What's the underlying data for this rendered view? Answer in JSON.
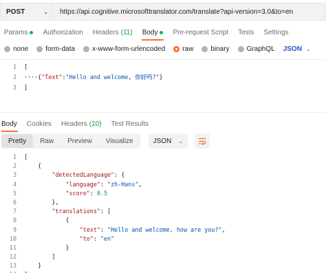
{
  "request": {
    "method": "POST",
    "url": "https://api.cognitive.microsofttranslator.com/translate?api-version=3.0&to=en"
  },
  "request_tabs": [
    {
      "label": "Params",
      "dot": true,
      "active": false
    },
    {
      "label": "Authorization",
      "active": false
    },
    {
      "label": "Headers",
      "count": "(11)",
      "active": false
    },
    {
      "label": "Body",
      "dot": true,
      "active": true
    },
    {
      "label": "Pre-request Script",
      "active": false
    },
    {
      "label": "Tests",
      "active": false
    },
    {
      "label": "Settings",
      "active": false
    }
  ],
  "body_types": [
    {
      "label": "none",
      "selected": false
    },
    {
      "label": "form-data",
      "selected": false
    },
    {
      "label": "x-www-form-urlencoded",
      "selected": false
    },
    {
      "label": "raw",
      "selected": true
    },
    {
      "label": "binary",
      "selected": false
    },
    {
      "label": "GraphQL",
      "selected": false
    }
  ],
  "raw_language": "JSON",
  "request_body": {
    "line_numbers": [
      "1",
      "2",
      "3"
    ],
    "line1": "[",
    "line2_key": "\"Text\"",
    "line2_value": "\"Hello and welcome, 你好吗?\"",
    "line3": "]"
  },
  "response_tabs": [
    {
      "label": "Body",
      "active": true
    },
    {
      "label": "Cookies",
      "active": false
    },
    {
      "label": "Headers",
      "count": "(10)",
      "active": false
    },
    {
      "label": "Test Results",
      "active": false
    }
  ],
  "response_views": [
    {
      "label": "Pretty",
      "active": true
    },
    {
      "label": "Raw",
      "active": false
    },
    {
      "label": "Preview",
      "active": false
    },
    {
      "label": "Visualize",
      "active": false
    }
  ],
  "response_format": "JSON",
  "response_body": {
    "line_numbers": [
      "1",
      "2",
      "3",
      "4",
      "5",
      "6",
      "7",
      "8",
      "9",
      "10",
      "11",
      "12",
      "13",
      "14"
    ],
    "detected_key": "\"detectedLanguage\"",
    "language_key": "\"language\"",
    "language_value": "\"zh-Hans\"",
    "score_key": "\"score\"",
    "score_value": "0.5",
    "translations_key": "\"translations\"",
    "text_key": "\"text\"",
    "text_value": "\"Hello and welcome, how are you?\"",
    "to_key": "\"to\"",
    "to_value": "\"en\""
  },
  "colors": {
    "accent": "#ff6c37",
    "status_dot": "#0cbb52",
    "json_key": "#a31515",
    "json_string": "#0451a5",
    "json_number": "#098658"
  }
}
